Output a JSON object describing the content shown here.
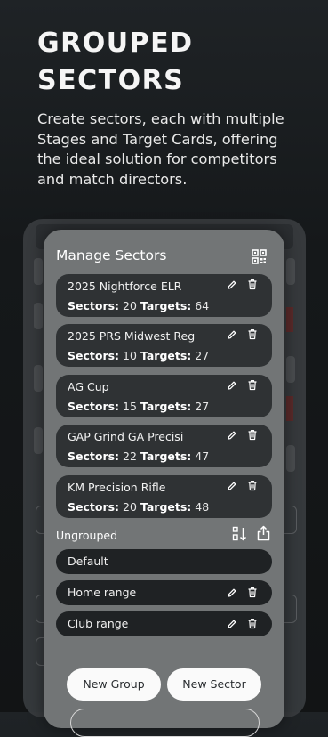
{
  "headline": {
    "line1": "GROUPED",
    "line2": "SECTORS"
  },
  "subtitle": "Create sectors, each with multiple Stages and Target Cards, offering the ideal solution for competitors and match directors.",
  "panel": {
    "title": "Manage Sectors",
    "qr_icon": "qr-code-icon",
    "stat_labels": {
      "sectors": "Sectors:",
      "targets": "Targets:"
    },
    "groups": [
      {
        "name": "2025 Nightforce ELR",
        "sectors": "20",
        "targets": "64"
      },
      {
        "name": "2025 PRS Midwest Reg",
        "sectors": "10",
        "targets": "27"
      },
      {
        "name": "AG Cup",
        "sectors": "15",
        "targets": "27"
      },
      {
        "name": "GAP Grind GA Precisi",
        "sectors": "22",
        "targets": "47"
      },
      {
        "name": "KM Precision Rifle",
        "sectors": "20",
        "targets": "48"
      }
    ],
    "ungrouped_label": "Ungrouped",
    "ungrouped": [
      {
        "name": "Default"
      },
      {
        "name": "Home range"
      },
      {
        "name": "Club range"
      }
    ],
    "buttons": {
      "new_group": "New Group",
      "new_sector": "New Sector"
    }
  },
  "colors": {
    "panel": "#727576",
    "card": "#2f3234",
    "pill": "#1f2224",
    "button": "#fafafa"
  }
}
